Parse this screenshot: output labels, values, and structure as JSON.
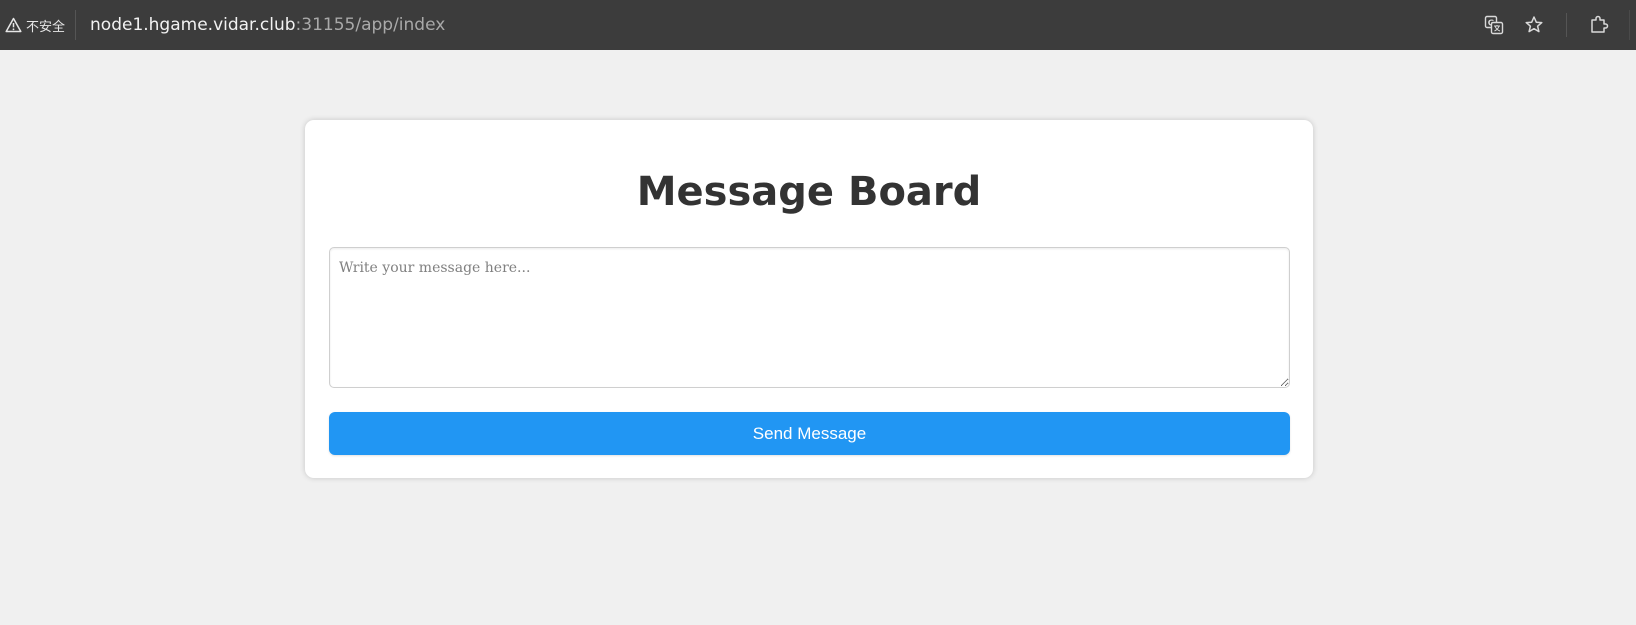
{
  "browser": {
    "security_label": "不安全",
    "url_host": "node1.hgame.vidar.club",
    "url_rest": ":31155/app/index",
    "icons": [
      "warning-icon",
      "translate-icon",
      "star-icon",
      "extensions-icon"
    ]
  },
  "page": {
    "title": "Message Board",
    "message_placeholder": "Write your message here...",
    "message_value": "",
    "send_label": "Send Message"
  },
  "colors": {
    "background": "#f0f0f0",
    "card": "#ffffff",
    "accent": "#2196f3",
    "title": "#333333",
    "browser_bar": "#3c3c3c"
  }
}
